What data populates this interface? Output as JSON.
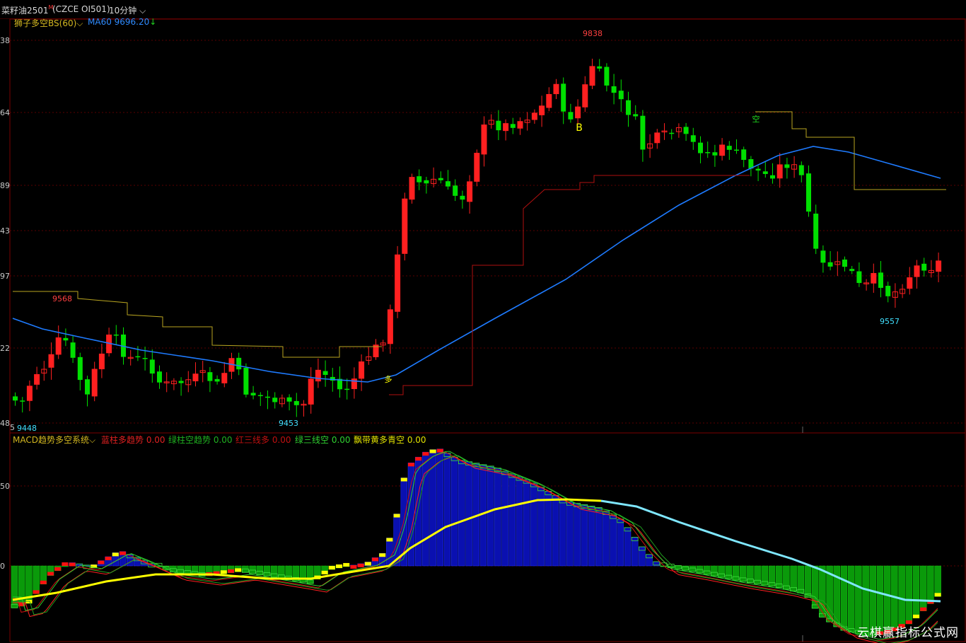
{
  "window": {
    "symbol": "菜籽油2501",
    "symbol_flag": "M",
    "contract": "(CZCE OI501)",
    "period": "10分钟"
  },
  "main_indicators": {
    "lion_label": "狮子多空BS(60)",
    "ma_label": "MA60 9696.20",
    "ma_arrow": "↓"
  },
  "macd_indicators": {
    "title": "MACD趋势多空系统",
    "items": [
      {
        "label": "蓝柱多趋势",
        "value": "0.00",
        "color": "#e02020"
      },
      {
        "label": "绿柱空趋势",
        "value": "0.00",
        "color": "#20b020"
      },
      {
        "label": "红三线多",
        "value": "0.00",
        "color": "#c01010"
      },
      {
        "label": "绿三线空",
        "value": "0.00",
        "color": "#30d030"
      },
      {
        "label": "飘带黄多青空",
        "value": "0.00",
        "color": "#e0e000"
      }
    ]
  },
  "axis": {
    "price_ticks": [
      "38",
      "64",
      "89",
      "43",
      "97",
      "22",
      "48"
    ],
    "macd_ticks": [
      "50",
      "0"
    ],
    "bottom_left": "5"
  },
  "annotations": {
    "high": "9838",
    "left_high": "9568",
    "low_left": "9448",
    "low_mid": "9453",
    "low_right": "9557",
    "buy": "B",
    "long_mark": "多",
    "short_mark": "空"
  },
  "colors": {
    "up": "#ff2020",
    "down": "#00e000",
    "ma": "#1e7bff",
    "stop": "#b8a420",
    "macd_blue": "#0a10b0",
    "macd_green": "#0a9a0a",
    "ribbon_yellow": "#ffff00",
    "ribbon_cyan": "#7fe7ff"
  },
  "watermark": "云棋赢指标公式网"
}
